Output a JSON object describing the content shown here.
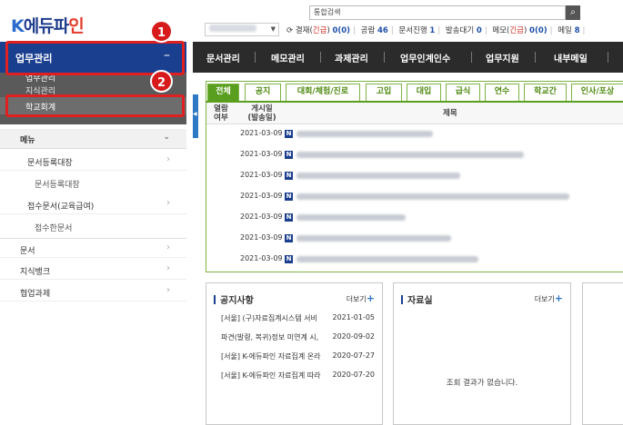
{
  "logo": {
    "k": "K",
    "rest": "에듀파",
    "pin": "인"
  },
  "search": {
    "placeholder": "통합검색",
    "button_icon": "search-icon"
  },
  "header": {
    "status": [
      {
        "label": "결재(",
        "urgent": "긴급",
        "tail": ") ",
        "count": "0(0)"
      },
      {
        "label": "공람 ",
        "count": "46"
      },
      {
        "label": "문서진행 ",
        "count": "1"
      },
      {
        "label": "발송대기 ",
        "count": "0"
      },
      {
        "label": "메모(",
        "urgent": "긴급",
        "tail": ") ",
        "count": "0(0)"
      },
      {
        "label": "메일 ",
        "count": "8"
      }
    ]
  },
  "sidebar": {
    "title": "업무관리",
    "collapse_symbol": "–",
    "sub_items": [
      "업무관리",
      "지식관리",
      "학교회계"
    ],
    "menu_label": "메뉴",
    "items": [
      {
        "label": "문서등록대장",
        "level": 1,
        "arrow": "›"
      },
      {
        "label": "문서등록대장",
        "level": 2
      },
      {
        "label": "접수문서(교육급여)",
        "level": 1,
        "arrow": "›"
      },
      {
        "label": "접수한문서",
        "level": 2
      },
      {
        "label": "문서",
        "level": 0,
        "arrow": "›"
      },
      {
        "label": "지식뱅크",
        "level": 0,
        "arrow": "›"
      },
      {
        "label": "협업과제",
        "level": 0,
        "arrow": "›"
      }
    ]
  },
  "topnav": [
    "문서관리",
    "메모관리",
    "과제관리",
    "업무인계인수",
    "업무지원",
    "내부메일"
  ],
  "board": {
    "tabs": [
      "전체",
      "공지",
      "대회/체험/진로",
      "고입",
      "대입",
      "급식",
      "연수",
      "학교간",
      "인사/포상"
    ],
    "col_read": "열람\n여부",
    "col_date": "게시일\n(발송일)",
    "col_title": "제목",
    "rows": [
      {
        "date": "2021-03-09",
        "badge": "N"
      },
      {
        "date": "2021-03-09",
        "badge": "N"
      },
      {
        "date": "2021-03-09",
        "badge": "N"
      },
      {
        "date": "2021-03-09",
        "badge": "N"
      },
      {
        "date": "2021-03-09",
        "badge": "N"
      },
      {
        "date": "2021-03-09",
        "badge": "N"
      },
      {
        "date": "2021-03-09",
        "badge": "N"
      }
    ]
  },
  "notice": {
    "title": "공지사항",
    "more": "더보기",
    "rows": [
      {
        "title": "[서울] (구)자료집계시스템 서비",
        "date": "2021-01-05"
      },
      {
        "title": "파견(발령, 복귀)정보 미연계 시,",
        "date": "2020-09-02"
      },
      {
        "title": "[서울] K-에듀파인 자료집계 온라",
        "date": "2020-07-27"
      },
      {
        "title": "[서울] K-에듀파인 자료집계 따라",
        "date": "2020-07-20"
      }
    ]
  },
  "library": {
    "title": "자료실",
    "more": "더보기",
    "empty": "조회 결과가 없습니다."
  },
  "annotations": [
    "1",
    "2"
  ],
  "colors": {
    "nav_dark": "#2b2b2b",
    "sidebar_blue": "#1b3f8f",
    "tab_green": "#5a9e1f",
    "highlight_red": "#e02020"
  }
}
